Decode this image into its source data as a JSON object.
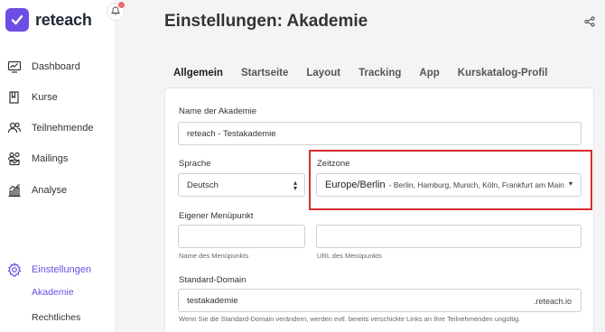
{
  "brand": {
    "name": "reteach",
    "accent": "#6d4de4"
  },
  "sidebar": {
    "items": [
      {
        "label": "Dashboard",
        "icon": "dashboard-icon"
      },
      {
        "label": "Kurse",
        "icon": "book-icon"
      },
      {
        "label": "Teilnehmende",
        "icon": "users-icon"
      },
      {
        "label": "Mailings",
        "icon": "mail-users-icon"
      },
      {
        "label": "Analyse",
        "icon": "chart-icon"
      }
    ],
    "settings": {
      "label": "Einstellungen",
      "icon": "gear-icon"
    },
    "subitems": [
      {
        "label": "Akademie",
        "active": true
      },
      {
        "label": "Rechtliches",
        "active": false
      }
    ]
  },
  "header": {
    "title": "Einstellungen: Akademie"
  },
  "tabs": [
    "Allgemein",
    "Startseite",
    "Layout",
    "Tracking",
    "App",
    "Kurskatalog-Profil"
  ],
  "form": {
    "academy_name": {
      "label": "Name der Akademie",
      "value": "reteach - Testakademie"
    },
    "language": {
      "label": "Sprache",
      "value": "Deutsch"
    },
    "timezone": {
      "label": "Zeitzone",
      "value": "Europe/Berlin",
      "detail": "- Berlin, Hamburg, Munich, Köln, Frankfurt am Main"
    },
    "menu": {
      "label": "Eigener Menüpunkt",
      "name_hint": "Name des Menüpunkts",
      "url_hint": "URL des Menüpunkts",
      "name_value": "",
      "url_value": ""
    },
    "domain": {
      "label": "Standard-Domain",
      "value": "testakademie",
      "suffix": ".reteach.io",
      "hint": "Wenn Sie die Standard-Domain verändern, werden evtl. bereits verschickte Links an Ihre Teilnehmenden ungültig."
    }
  },
  "colors": {
    "highlight": "#d62c2c",
    "notification": "#ef6b6b"
  }
}
